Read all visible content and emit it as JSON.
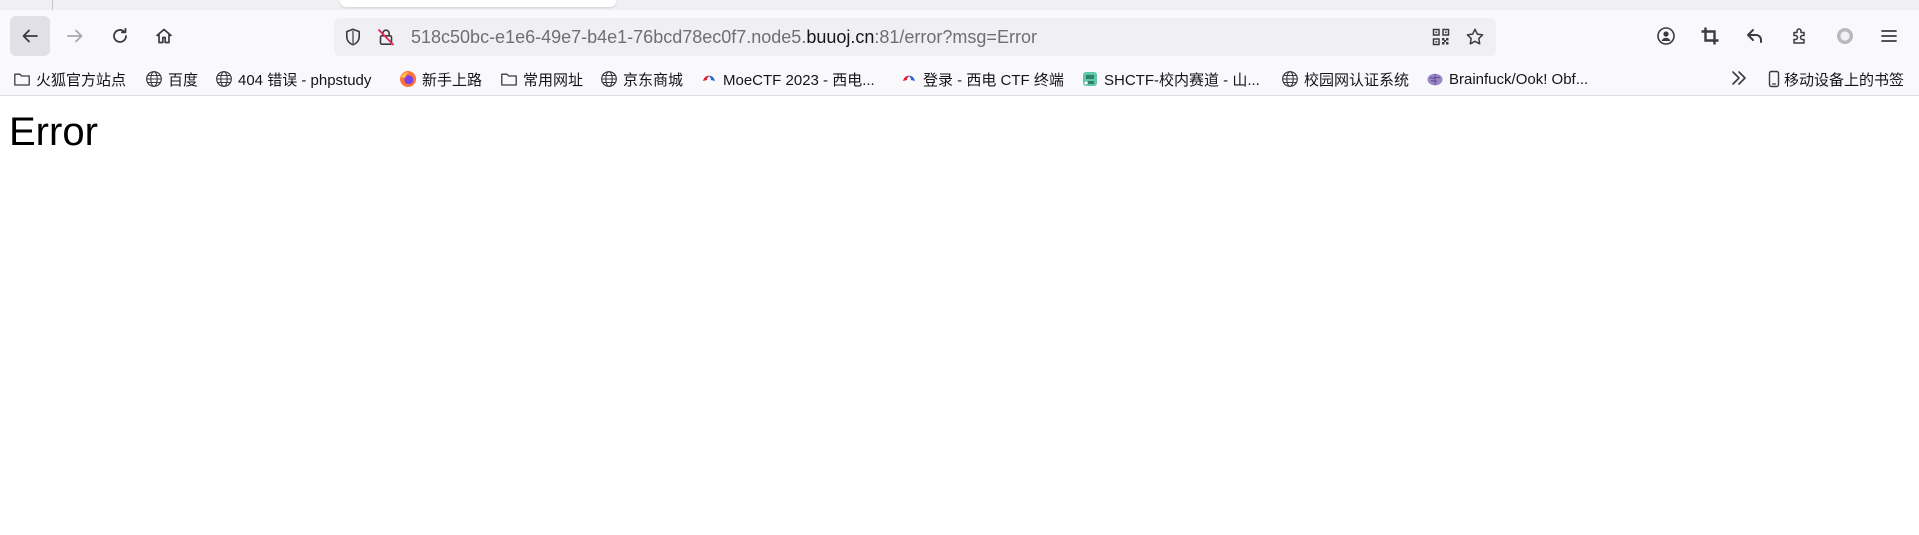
{
  "nav": {
    "url_prefix": "518c50bc-e1e6-49e7-b4e1-76bcd78ec0f7.node5.",
    "url_domain": "buuoj.cn",
    "url_suffix": ":81/error?msg=Error"
  },
  "bookmarks": {
    "items": [
      {
        "label": "火狐官方站点",
        "icon": "folder-icon"
      },
      {
        "label": "百度",
        "icon": "globe-icon"
      },
      {
        "label": "404 错误 - phpstudy",
        "icon": "globe-icon"
      },
      {
        "label": "新手上路",
        "icon": "firefox-icon"
      },
      {
        "label": "常用网址",
        "icon": "folder-icon"
      },
      {
        "label": "京东商城",
        "icon": "globe-icon"
      },
      {
        "label": "MoeCTF 2023 - 西电...",
        "icon": "ctf-site-icon"
      },
      {
        "label": "登录 - 西电 CTF 终端",
        "icon": "ctf-site-icon"
      },
      {
        "label": "SHCTF-校内赛道 - 山...",
        "icon": "shctf-icon"
      },
      {
        "label": "校园网认证系统",
        "icon": "globe-icon"
      },
      {
        "label": "Brainfuck/Ook! Obf...",
        "icon": "brain-icon"
      }
    ],
    "mobile_label": "移动设备上的书签"
  },
  "page": {
    "heading": "Error"
  }
}
